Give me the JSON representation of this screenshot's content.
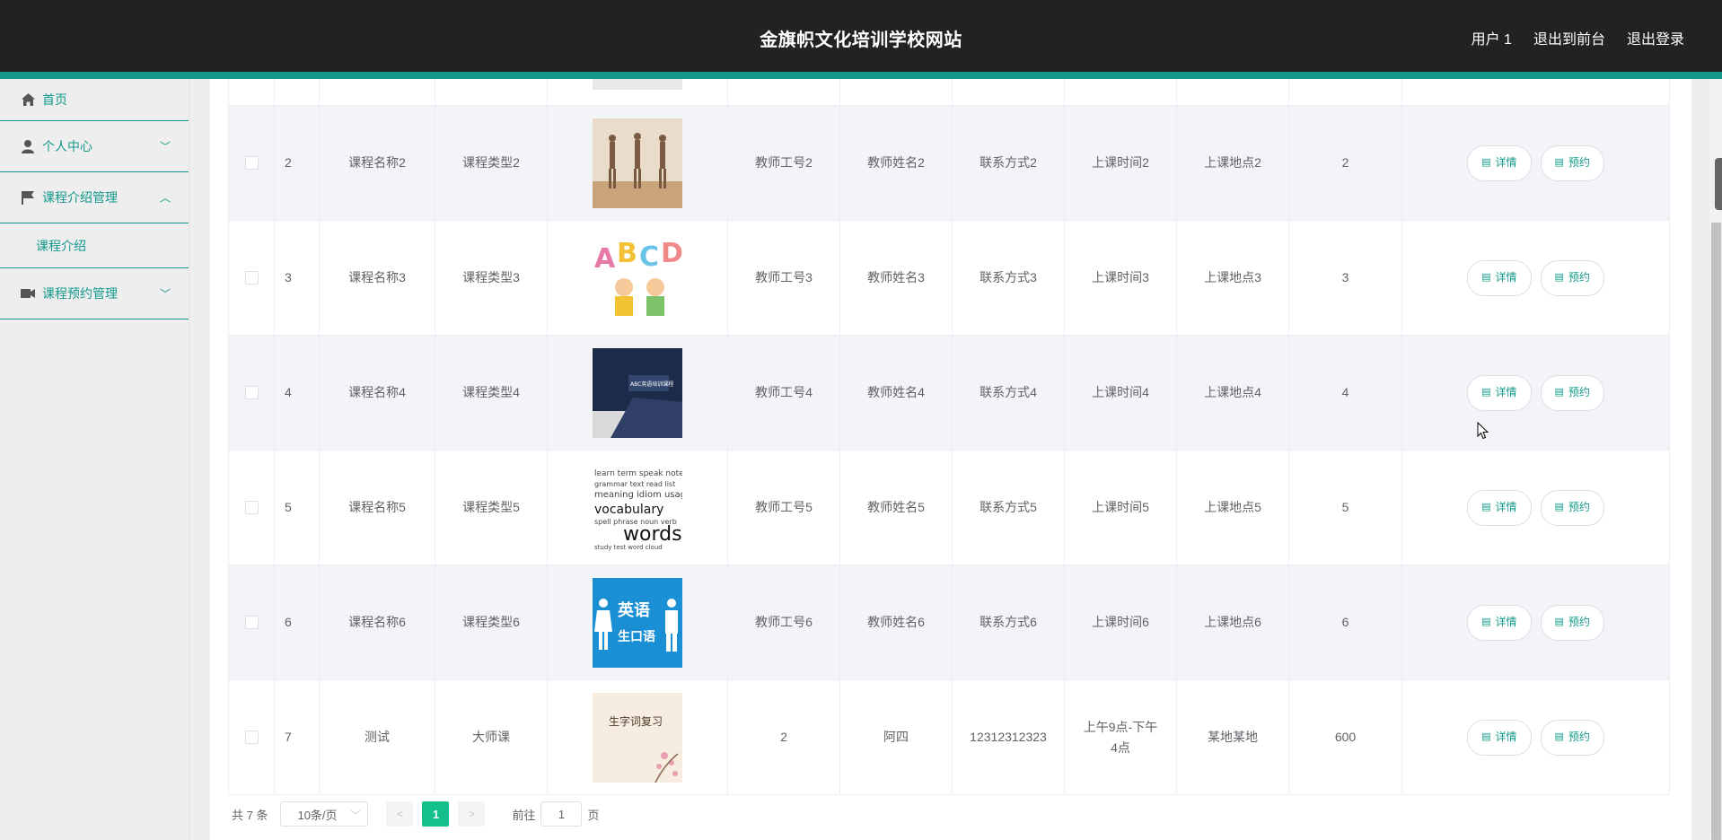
{
  "header": {
    "title": "金旗帜文化培训学校网站",
    "links": [
      "用户 1",
      "退出到前台",
      "退出登录"
    ]
  },
  "sidebar": {
    "items": [
      {
        "label": "首页",
        "icon": "home-icon"
      },
      {
        "label": "个人中心",
        "icon": "user-icon",
        "arrow": "﹀"
      },
      {
        "label": "课程介绍管理",
        "icon": "flag-icon",
        "arrow": "︿"
      },
      {
        "label": "课程介绍",
        "sub": true
      },
      {
        "label": "课程预约管理",
        "icon": "video-icon",
        "arrow": "﹀"
      }
    ]
  },
  "table": {
    "rows": [
      {
        "idx": "2",
        "name": "课程名称2",
        "type": "课程类型2",
        "teacher_id": "教师工号2",
        "teacher": "教师姓名2",
        "contact": "联系方式2",
        "time": "上课时间2",
        "place": "上课地点2",
        "count": "2",
        "image": "dance"
      },
      {
        "idx": "3",
        "name": "课程名称3",
        "type": "课程类型3",
        "teacher_id": "教师工号3",
        "teacher": "教师姓名3",
        "contact": "联系方式3",
        "time": "上课时间3",
        "place": "上课地点3",
        "count": "3",
        "image": "abcd"
      },
      {
        "idx": "4",
        "name": "课程名称4",
        "type": "课程类型4",
        "teacher_id": "教师工号4",
        "teacher": "教师姓名4",
        "contact": "联系方式4",
        "time": "上课时间4",
        "place": "上课地点4",
        "count": "4",
        "image": "study"
      },
      {
        "idx": "5",
        "name": "课程名称5",
        "type": "课程类型5",
        "teacher_id": "教师工号5",
        "teacher": "教师姓名5",
        "contact": "联系方式5",
        "time": "上课时间5",
        "place": "上课地点5",
        "count": "5",
        "image": "words"
      },
      {
        "idx": "6",
        "name": "课程名称6",
        "type": "课程类型6",
        "teacher_id": "教师工号6",
        "teacher": "教师姓名6",
        "contact": "联系方式6",
        "time": "上课时间6",
        "place": "上课地点6",
        "count": "6",
        "image": "english"
      },
      {
        "idx": "7",
        "name": "测试",
        "type": "大师课",
        "teacher_id": "2",
        "teacher": "阿四",
        "contact": "12312312323",
        "time": "上午9点-下午4点",
        "place": "某地某地",
        "count": "600",
        "image": "vocab"
      }
    ],
    "detail_label": "详情",
    "book_label": "预约",
    "image_text": {
      "words_big": "words",
      "words_small": "vocabulary",
      "english_top": "英语",
      "english_bottom": "生口语",
      "vocab": "生字词复习",
      "study": "ABC英语培训课程"
    }
  },
  "pagination": {
    "total": "共 7 条",
    "page_size": "10条/页",
    "current": "1",
    "goto_label": "前往",
    "goto_value": "1",
    "page_unit": "页"
  },
  "colors": {
    "accent": "#13998c",
    "page_active": "#13c08c",
    "header_bg": "#222222"
  }
}
